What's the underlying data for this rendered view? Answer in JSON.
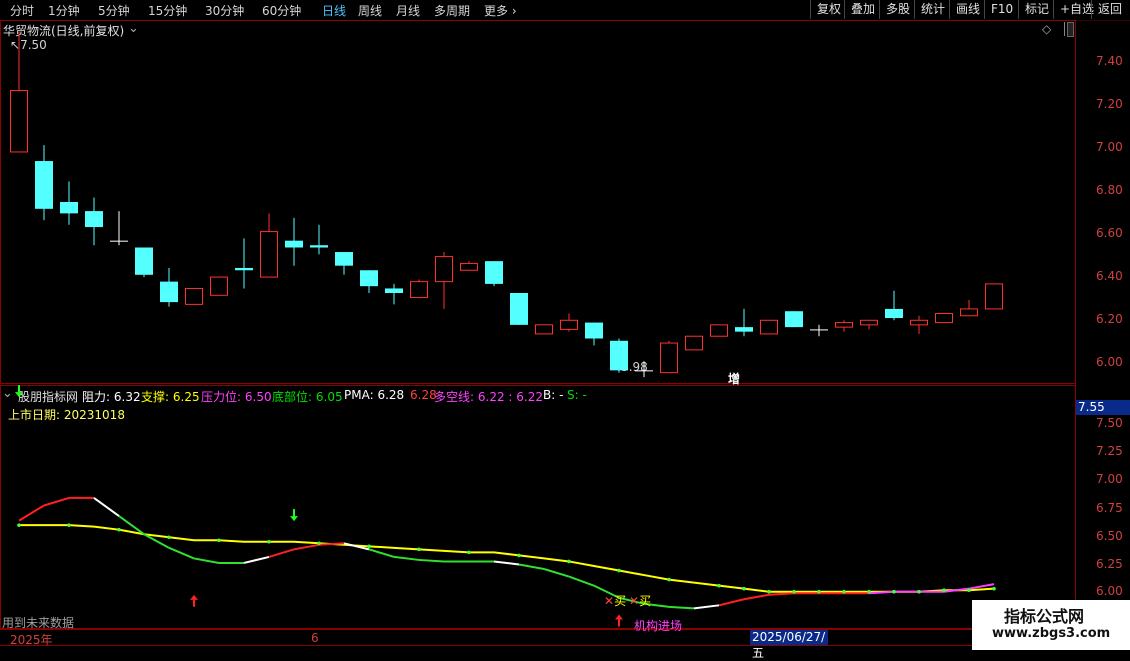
{
  "toolbar": {
    "periods": [
      "分时",
      "1分钟",
      "5分钟",
      "15分钟",
      "30分钟",
      "60分钟",
      "日线",
      "周线",
      "月线",
      "多周期",
      "更多"
    ],
    "active_index": 6,
    "right_buttons": [
      "复权",
      "叠加",
      "多股",
      "统计",
      "画线",
      "F10",
      "标记",
      "+自选",
      "返回"
    ]
  },
  "main_panel": {
    "title": "华贸物流(日线,前复权)",
    "high_label": "7.50",
    "low_label": "5.98",
    "price_axis": [
      "7.40",
      "7.20",
      "7.00",
      "6.80",
      "6.60",
      "6.40",
      "6.20",
      "6.00"
    ],
    "event_tag": "增"
  },
  "indicator_panel": {
    "name": "股朋指标网",
    "items": [
      {
        "label": "阻力",
        "value": "6.32",
        "color": "#ffffff"
      },
      {
        "label": "支撑",
        "value": "6.25",
        "color": "#ffff00"
      },
      {
        "label": "压力位",
        "value": "6.50",
        "color": "#ff40ff"
      },
      {
        "label": "底部位",
        "value": "6.05",
        "color": "#00e000"
      },
      {
        "label": "PMA",
        "value": "6.28",
        "color": "#ffffff"
      }
    ],
    "extra_value": "6.28",
    "multi_label": "多空线",
    "multi_values": "6.22 : 6.22",
    "b_label": "B: -",
    "s_label": "S: -",
    "listing_date_label": "上市日期",
    "listing_date": "20231018",
    "current_value": "7.55",
    "axis": [
      "7.50",
      "7.25",
      "7.00",
      "6.75",
      "6.50",
      "6.25",
      "6.00"
    ],
    "buy_marker": "买",
    "institution_label": "机构进场",
    "future_data_note": "用到未来数据"
  },
  "time_axis": {
    "start_label": "2025年",
    "month_label": "6",
    "cursor_date": "2025/06/27/五"
  },
  "watermark": {
    "line1": "指标公式网",
    "line2": "www.zbgs3.com"
  },
  "chart_data": {
    "type": "candlestick",
    "ylim": [
      5.95,
      7.55
    ],
    "candles": [
      {
        "o": 6.97,
        "h": 7.5,
        "l": 6.97,
        "c": 7.24
      },
      {
        "o": 6.93,
        "h": 7.0,
        "l": 6.67,
        "c": 6.72
      },
      {
        "o": 6.75,
        "h": 6.84,
        "l": 6.65,
        "c": 6.7
      },
      {
        "o": 6.71,
        "h": 6.77,
        "l": 6.56,
        "c": 6.64
      },
      {
        "o": 6.58,
        "h": 6.71,
        "l": 6.56,
        "c": 6.58
      },
      {
        "o": 6.55,
        "h": 6.55,
        "l": 6.42,
        "c": 6.43
      },
      {
        "o": 6.4,
        "h": 6.46,
        "l": 6.29,
        "c": 6.31
      },
      {
        "o": 6.3,
        "h": 6.37,
        "l": 6.3,
        "c": 6.37
      },
      {
        "o": 6.34,
        "h": 6.42,
        "l": 6.34,
        "c": 6.42
      },
      {
        "o": 6.46,
        "h": 6.59,
        "l": 6.37,
        "c": 6.45
      },
      {
        "o": 6.42,
        "h": 6.7,
        "l": 6.42,
        "c": 6.62
      },
      {
        "o": 6.58,
        "h": 6.68,
        "l": 6.47,
        "c": 6.55
      },
      {
        "o": 6.56,
        "h": 6.65,
        "l": 6.52,
        "c": 6.55
      },
      {
        "o": 6.53,
        "h": 6.53,
        "l": 6.43,
        "c": 6.47
      },
      {
        "o": 6.45,
        "h": 6.45,
        "l": 6.35,
        "c": 6.38
      },
      {
        "o": 6.37,
        "h": 6.39,
        "l": 6.3,
        "c": 6.35
      },
      {
        "o": 6.33,
        "h": 6.41,
        "l": 6.33,
        "c": 6.4
      },
      {
        "o": 6.4,
        "h": 6.53,
        "l": 6.28,
        "c": 6.51
      },
      {
        "o": 6.45,
        "h": 6.49,
        "l": 6.45,
        "c": 6.48
      },
      {
        "o": 6.49,
        "h": 6.49,
        "l": 6.38,
        "c": 6.39
      },
      {
        "o": 6.35,
        "h": 6.35,
        "l": 6.21,
        "c": 6.21
      },
      {
        "o": 6.17,
        "h": 6.21,
        "l": 6.17,
        "c": 6.21
      },
      {
        "o": 6.19,
        "h": 6.26,
        "l": 6.18,
        "c": 6.23
      },
      {
        "o": 6.22,
        "h": 6.22,
        "l": 6.12,
        "c": 6.15
      },
      {
        "o": 6.14,
        "h": 6.15,
        "l": 6.0,
        "c": 6.01
      },
      {
        "o": 6.01,
        "h": 6.05,
        "l": 5.98,
        "c": 6.01
      },
      {
        "o": 6.0,
        "h": 6.14,
        "l": 6.0,
        "c": 6.13
      },
      {
        "o": 6.1,
        "h": 6.16,
        "l": 6.1,
        "c": 6.16
      },
      {
        "o": 6.16,
        "h": 6.21,
        "l": 6.16,
        "c": 6.21
      },
      {
        "o": 6.2,
        "h": 6.28,
        "l": 6.16,
        "c": 6.18
      },
      {
        "o": 6.17,
        "h": 6.23,
        "l": 6.17,
        "c": 6.23
      },
      {
        "o": 6.27,
        "h": 6.27,
        "l": 6.2,
        "c": 6.2
      },
      {
        "o": 6.19,
        "h": 6.21,
        "l": 6.16,
        "c": 6.19
      },
      {
        "o": 6.2,
        "h": 6.23,
        "l": 6.18,
        "c": 6.22
      },
      {
        "o": 6.21,
        "h": 6.23,
        "l": 6.19,
        "c": 6.23
      },
      {
        "o": 6.28,
        "h": 6.36,
        "l": 6.23,
        "c": 6.24
      },
      {
        "o": 6.21,
        "h": 6.25,
        "l": 6.17,
        "c": 6.23
      },
      {
        "o": 6.22,
        "h": 6.26,
        "l": 6.22,
        "c": 6.26
      },
      {
        "o": 6.25,
        "h": 6.32,
        "l": 6.25,
        "c": 6.28
      },
      {
        "o": 6.28,
        "h": 6.39,
        "l": 6.28,
        "c": 6.39
      }
    ],
    "indicator": {
      "ylim": [
        5.98,
        7.58
      ],
      "main_line": [
        6.69,
        6.79,
        6.84,
        6.84,
        6.72,
        6.6,
        6.51,
        6.44,
        6.41,
        6.41,
        6.45,
        6.5,
        6.53,
        6.54,
        6.5,
        6.45,
        6.43,
        6.42,
        6.42,
        6.42,
        6.4,
        6.37,
        6.32,
        6.26,
        6.18,
        6.14,
        6.12,
        6.11,
        6.13,
        6.17,
        6.2,
        6.21,
        6.21,
        6.21,
        6.21,
        6.22,
        6.22,
        6.22,
        6.24,
        6.27
      ],
      "main_colors": [
        "red",
        "red",
        "red",
        "white",
        "green",
        "green",
        "green",
        "green",
        "green",
        "white",
        "red",
        "red",
        "red",
        "white",
        "green",
        "green",
        "green",
        "green",
        "green",
        "white",
        "green",
        "green",
        "green",
        "green",
        "green",
        "green",
        "green",
        "white",
        "red",
        "red",
        "red",
        "red",
        "red",
        "red",
        "magenta",
        "magenta",
        "magenta",
        "magenta",
        "magenta",
        "red"
      ],
      "support_line": [
        6.66,
        6.66,
        6.66,
        6.65,
        6.63,
        6.6,
        6.58,
        6.56,
        6.56,
        6.55,
        6.55,
        6.55,
        6.54,
        6.53,
        6.52,
        6.51,
        6.5,
        6.49,
        6.48,
        6.48,
        6.46,
        6.44,
        6.42,
        6.39,
        6.36,
        6.33,
        6.3,
        6.28,
        6.26,
        6.24,
        6.22,
        6.22,
        6.22,
        6.22,
        6.22,
        6.22,
        6.22,
        6.23,
        6.23,
        6.24
      ],
      "up_arrows": [
        {
          "i": 7,
          "v": 6.12
        },
        {
          "i": 24,
          "v": 5.99
        }
      ],
      "down_arrows": [
        {
          "i": 0,
          "v": 7.52
        },
        {
          "i": 11,
          "v": 6.7
        }
      ],
      "buy_points": [
        24,
        25
      ]
    }
  }
}
